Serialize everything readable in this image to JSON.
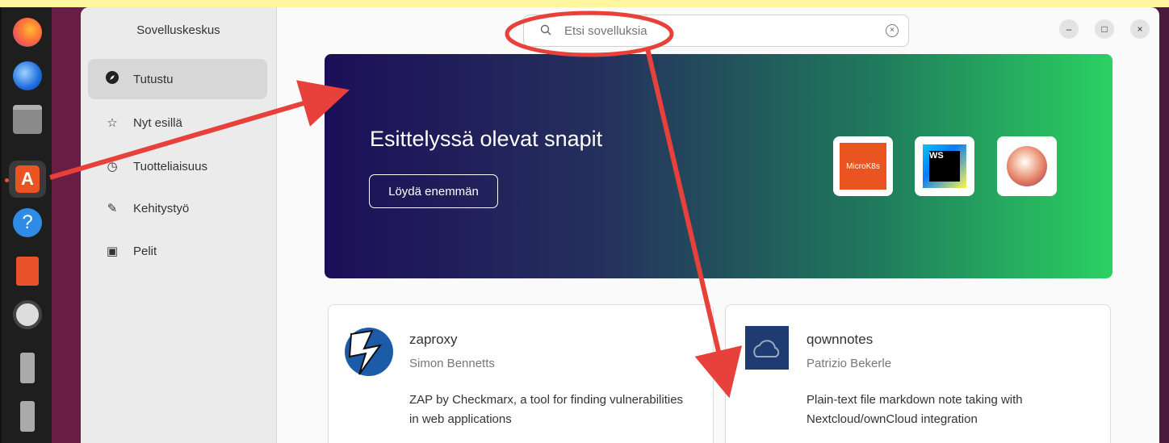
{
  "sidebar": {
    "title": "Sovelluskeskus",
    "items": [
      {
        "label": "Tutustu",
        "icon": "compass-icon"
      },
      {
        "label": "Nyt esillä",
        "icon": "star-icon"
      },
      {
        "label": "Tuotteliaisuus",
        "icon": "clock-icon"
      },
      {
        "label": "Kehitystyö",
        "icon": "wrench-icon"
      },
      {
        "label": "Pelit",
        "icon": "gamepad-icon"
      }
    ]
  },
  "search": {
    "placeholder": "Etsi sovelluksia"
  },
  "banner": {
    "title": "Esittelyssä olevat snapit",
    "button_label": "Löydä enemmän",
    "tiles": [
      "MicroK8s",
      "WS",
      ""
    ]
  },
  "cards": [
    {
      "name": "zaproxy",
      "author": "Simon Bennetts",
      "description": "ZAP by Checkmarx, a tool for finding vulnerabilities in web applications"
    },
    {
      "name": "qownnotes",
      "author": "Patrizio Bekerle",
      "description": "Plain-text file markdown note taking with Nextcloud/ownCloud integration"
    }
  ],
  "colors": {
    "accent": "#e95420",
    "annotation": "#e8403a",
    "banner_start": "#1c0f58",
    "banner_end": "#2bd162"
  }
}
